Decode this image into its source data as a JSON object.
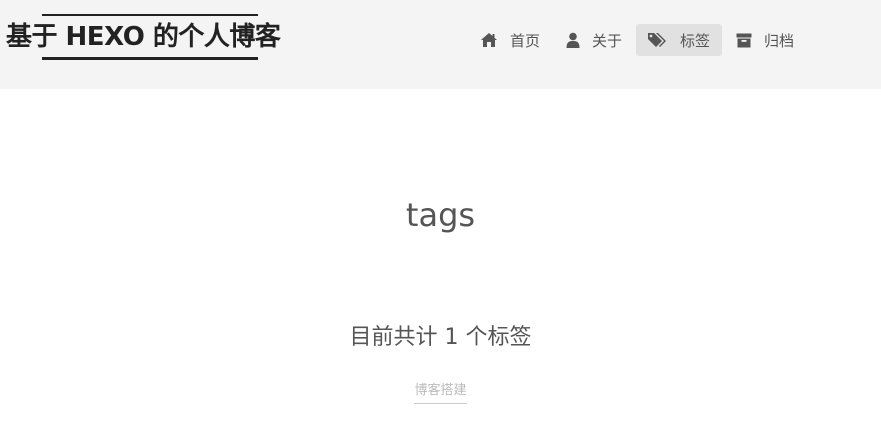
{
  "site": {
    "brand": "基于 HEXO 的个人博客"
  },
  "nav": {
    "items": [
      {
        "label": "首页",
        "icon": "home-icon",
        "active": false
      },
      {
        "label": "关于",
        "icon": "user-icon",
        "active": false
      },
      {
        "label": "标签",
        "icon": "tags-icon",
        "active": true
      },
      {
        "label": "归档",
        "icon": "archive-icon",
        "active": false
      }
    ]
  },
  "main": {
    "title": "tags",
    "tag_count_text": "目前共计 1 个标签",
    "tags": [
      {
        "label": "博客搭建"
      }
    ]
  },
  "colors": {
    "header_bg": "#f4f4f4",
    "active_nav_bg": "#e1e1e1",
    "text": "#555555",
    "brand": "#222222",
    "tag": "#bbbbbb"
  }
}
